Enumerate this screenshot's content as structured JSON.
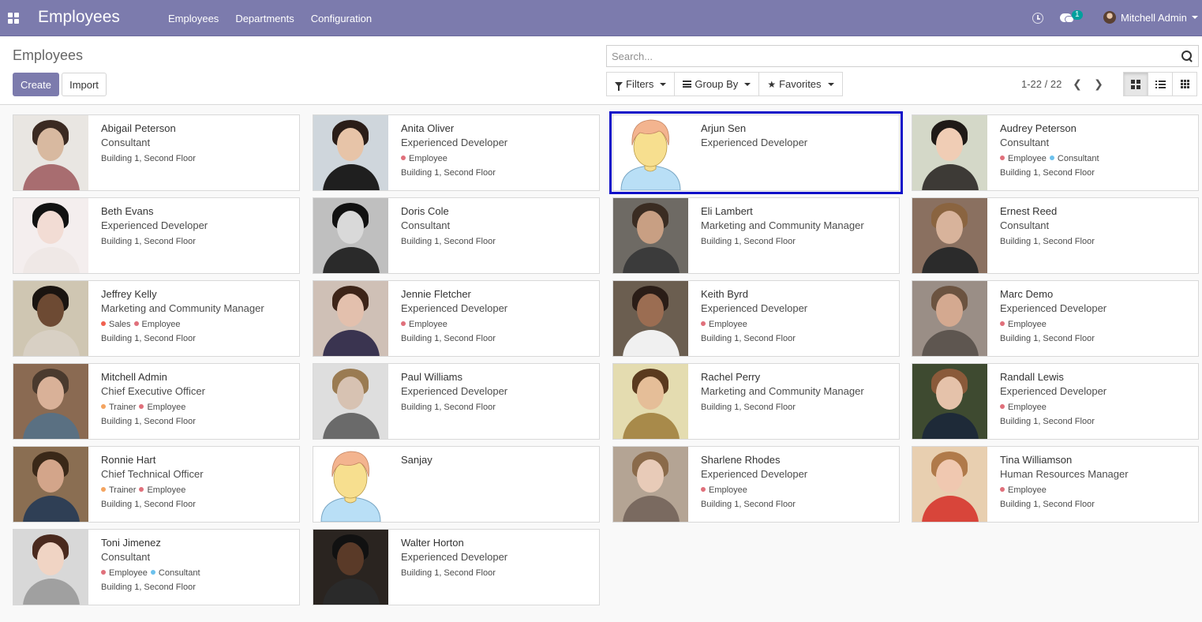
{
  "app": {
    "brand": "Employees",
    "menu": [
      "Employees",
      "Departments",
      "Configuration"
    ],
    "chat_badge": "1",
    "user_name": "Mitchell Admin"
  },
  "control": {
    "breadcrumb": "Employees",
    "create_label": "Create",
    "import_label": "Import",
    "search_placeholder": "Search...",
    "filters_label": "Filters",
    "groupby_label": "Group By",
    "favorites_label": "Favorites",
    "pager": "1-22 / 22"
  },
  "colors": {
    "navbar": "#7c7bad",
    "tag_employee": "#e0707b",
    "tag_consultant": "#6cc1ed",
    "tag_sales": "#f06050",
    "tag_trainer": "#f4a460",
    "selection": "#1010c8"
  },
  "employees": [
    {
      "name": "Abigail Peterson",
      "job": "Consultant",
      "tags": [],
      "location": "Building 1, Second Floor"
    },
    {
      "name": "Anita Oliver",
      "job": "Experienced Developer",
      "tags": [
        {
          "label": "Employee",
          "color": "#e0707b"
        }
      ],
      "location": "Building 1, Second Floor"
    },
    {
      "name": "Arjun Sen",
      "job": "Experienced Developer",
      "tags": [],
      "location": ""
    },
    {
      "name": "Audrey Peterson",
      "job": "Consultant",
      "tags": [
        {
          "label": "Employee",
          "color": "#e0707b"
        },
        {
          "label": "Consultant",
          "color": "#6cc1ed"
        }
      ],
      "location": "Building 1, Second Floor"
    },
    {
      "name": "Beth Evans",
      "job": "Experienced Developer",
      "tags": [],
      "location": "Building 1, Second Floor"
    },
    {
      "name": "Doris Cole",
      "job": "Consultant",
      "tags": [],
      "location": "Building 1, Second Floor"
    },
    {
      "name": "Eli Lambert",
      "job": "Marketing and Community Manager",
      "tags": [],
      "location": "Building 1, Second Floor"
    },
    {
      "name": "Ernest Reed",
      "job": "Consultant",
      "tags": [],
      "location": "Building 1, Second Floor"
    },
    {
      "name": "Jeffrey Kelly",
      "job": "Marketing and Community Manager",
      "tags": [
        {
          "label": "Sales",
          "color": "#f06050"
        },
        {
          "label": "Employee",
          "color": "#e0707b"
        }
      ],
      "location": "Building 1, Second Floor"
    },
    {
      "name": "Jennie Fletcher",
      "job": "Experienced Developer",
      "tags": [
        {
          "label": "Employee",
          "color": "#e0707b"
        }
      ],
      "location": "Building 1, Second Floor"
    },
    {
      "name": "Keith Byrd",
      "job": "Experienced Developer",
      "tags": [
        {
          "label": "Employee",
          "color": "#e0707b"
        }
      ],
      "location": "Building 1, Second Floor"
    },
    {
      "name": "Marc Demo",
      "job": "Experienced Developer",
      "tags": [
        {
          "label": "Employee",
          "color": "#e0707b"
        }
      ],
      "location": "Building 1, Second Floor"
    },
    {
      "name": "Mitchell Admin",
      "job": "Chief Executive Officer",
      "tags": [
        {
          "label": "Trainer",
          "color": "#f4a460"
        },
        {
          "label": "Employee",
          "color": "#e0707b"
        }
      ],
      "location": "Building 1, Second Floor"
    },
    {
      "name": "Paul Williams",
      "job": "Experienced Developer",
      "tags": [],
      "location": "Building 1, Second Floor"
    },
    {
      "name": "Rachel Perry",
      "job": "Marketing and Community Manager",
      "tags": [],
      "location": "Building 1, Second Floor"
    },
    {
      "name": "Randall Lewis",
      "job": "Experienced Developer",
      "tags": [
        {
          "label": "Employee",
          "color": "#e0707b"
        }
      ],
      "location": "Building 1, Second Floor"
    },
    {
      "name": "Ronnie Hart",
      "job": "Chief Technical Officer",
      "tags": [
        {
          "label": "Trainer",
          "color": "#f4a460"
        },
        {
          "label": "Employee",
          "color": "#e0707b"
        }
      ],
      "location": "Building 1, Second Floor"
    },
    {
      "name": "Sanjay",
      "job": "",
      "tags": [],
      "location": ""
    },
    {
      "name": "Sharlene Rhodes",
      "job": "Experienced Developer",
      "tags": [
        {
          "label": "Employee",
          "color": "#e0707b"
        }
      ],
      "location": "Building 1, Second Floor"
    },
    {
      "name": "Tina Williamson",
      "job": "Human Resources Manager",
      "tags": [
        {
          "label": "Employee",
          "color": "#e0707b"
        }
      ],
      "location": "Building 1, Second Floor"
    },
    {
      "name": "Toni Jimenez",
      "job": "Consultant",
      "tags": [
        {
          "label": "Employee",
          "color": "#e0707b"
        },
        {
          "label": "Consultant",
          "color": "#6cc1ed"
        }
      ],
      "location": "Building 1, Second Floor"
    },
    {
      "name": "Walter Horton",
      "job": "Experienced Developer",
      "tags": [],
      "location": "Building 1, Second Floor"
    }
  ]
}
